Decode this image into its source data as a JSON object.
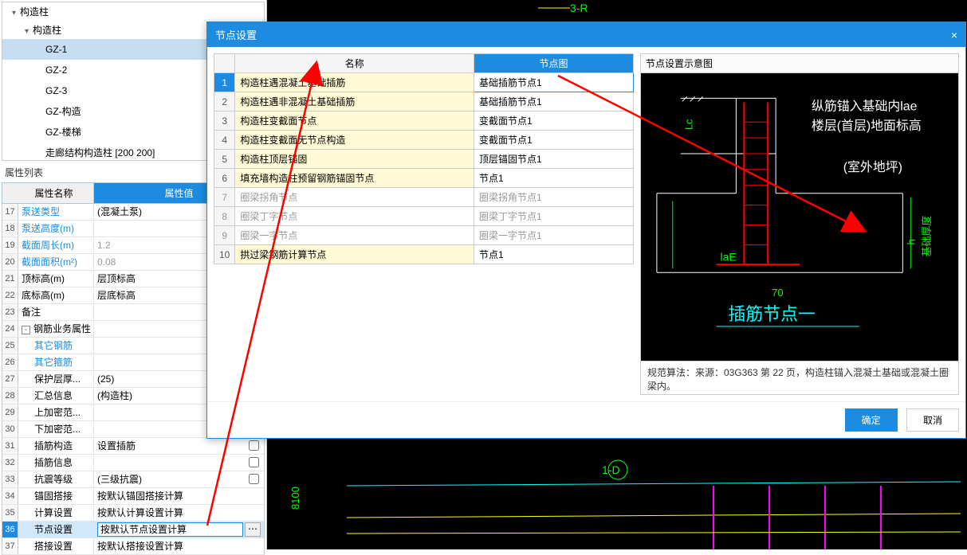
{
  "tree": {
    "root": "构造柱",
    "sub": "构造柱",
    "items": [
      "GZ-1",
      "GZ-2",
      "GZ-3",
      "GZ-构造",
      "GZ-楼梯",
      "走廊结构构造柱 [200 200]"
    ],
    "selected": 0
  },
  "propSection": "属性列表",
  "propHeader": {
    "name": "属性名称",
    "value": "属性值"
  },
  "props": [
    {
      "n": 17,
      "name": "泵送类型",
      "value": "(混凝土泵)",
      "blue": true
    },
    {
      "n": 18,
      "name": "泵送高度(m)",
      "value": "",
      "blue": true
    },
    {
      "n": 19,
      "name": "截面周长(m)",
      "value": "1.2",
      "blue": true,
      "gray": true
    },
    {
      "n": 20,
      "name": "截面面积(m²)",
      "value": "0.08",
      "blue": true,
      "gray": true
    },
    {
      "n": 21,
      "name": "顶标高(m)",
      "value": "层顶标高"
    },
    {
      "n": 22,
      "name": "底标高(m)",
      "value": "层底标高"
    },
    {
      "n": 23,
      "name": "备注",
      "value": ""
    },
    {
      "n": 24,
      "name": "钢筋业务属性",
      "value": "",
      "group": true,
      "expand": "-"
    },
    {
      "n": 25,
      "name": "其它钢筋",
      "value": "",
      "blue": true,
      "indent": true
    },
    {
      "n": 26,
      "name": "其它箍筋",
      "value": "",
      "blue": true,
      "indent": true
    },
    {
      "n": 27,
      "name": "保护层厚...",
      "value": "(25)",
      "indent": true,
      "cb": true
    },
    {
      "n": 28,
      "name": "汇总信息",
      "value": "(构造柱)",
      "indent": true,
      "cb": true
    },
    {
      "n": 29,
      "name": "上加密范...",
      "value": "",
      "indent": true,
      "cb": true
    },
    {
      "n": 30,
      "name": "下加密范...",
      "value": "",
      "indent": true,
      "cb": true
    },
    {
      "n": 31,
      "name": "插筋构造",
      "value": "设置插筋",
      "indent": true,
      "cb": true
    },
    {
      "n": 32,
      "name": "插筋信息",
      "value": "",
      "indent": true,
      "cb": true
    },
    {
      "n": 33,
      "name": "抗震等级",
      "value": "(三级抗震)",
      "indent": true,
      "cb": true
    },
    {
      "n": 34,
      "name": "锚固搭接",
      "value": "按默认锚固搭接计算",
      "indent": true
    },
    {
      "n": 35,
      "name": "计算设置",
      "value": "按默认计算设置计算",
      "indent": true
    },
    {
      "n": 36,
      "name": "节点设置",
      "value": "按默认节点设置计算",
      "indent": true,
      "highlight": true,
      "more": true
    },
    {
      "n": 37,
      "name": "搭接设置",
      "value": "按默认搭接设置计算",
      "indent": true
    }
  ],
  "dialog": {
    "title": "节点设置",
    "headers": {
      "name": "名称",
      "pic": "节点图"
    },
    "rows": [
      {
        "n": 1,
        "name": "构造柱遇混凝土基础插筋",
        "pic": "基础插筋节点1",
        "sel": true
      },
      {
        "n": 2,
        "name": "构造柱遇非混凝土基础插筋",
        "pic": "基础插筋节点1",
        "ed": true
      },
      {
        "n": 3,
        "name": "构造柱变截面节点",
        "pic": "变截面节点1",
        "ed": true
      },
      {
        "n": 4,
        "name": "构造柱变截面无节点构造",
        "pic": "变截面节点1",
        "ed": true
      },
      {
        "n": 5,
        "name": "构造柱顶层锚固",
        "pic": "顶层锚固节点1",
        "ed": true
      },
      {
        "n": 6,
        "name": "填充墙构造柱预留钢筋锚固节点",
        "pic": "节点1",
        "ed": true
      },
      {
        "n": 7,
        "name": "圈梁拐角节点",
        "pic": "圈梁拐角节点1",
        "ro": true
      },
      {
        "n": 8,
        "name": "圈梁丁字节点",
        "pic": "圈梁丁字节点1",
        "ro": true
      },
      {
        "n": 9,
        "name": "圈梁一字节点",
        "pic": "圈梁一字节点1",
        "ro": true
      },
      {
        "n": 10,
        "name": "拱过梁钢筋计算节点",
        "pic": "节点1",
        "ed": true
      }
    ],
    "diagram": {
      "header": "节点设置示意图",
      "labels": {
        "line1": "纵筋锚入基础内lae",
        "line2": "楼层(首层)地面标高",
        "line3": "(室外地坪)",
        "lae": "laE",
        "lc": "Lc",
        "h": "h",
        "depth": "基础厚度",
        "seventy": "70",
        "title": "插筋节点一"
      },
      "note": "规范算法：来源：03G363 第 22 页，构造柱锚入混凝土基础或混凝土圈梁内。"
    },
    "buttons": {
      "ok": "确定",
      "cancel": "取消"
    }
  },
  "cad": {
    "label1": "1-D",
    "label2": "8100",
    "label3": "3-R"
  }
}
